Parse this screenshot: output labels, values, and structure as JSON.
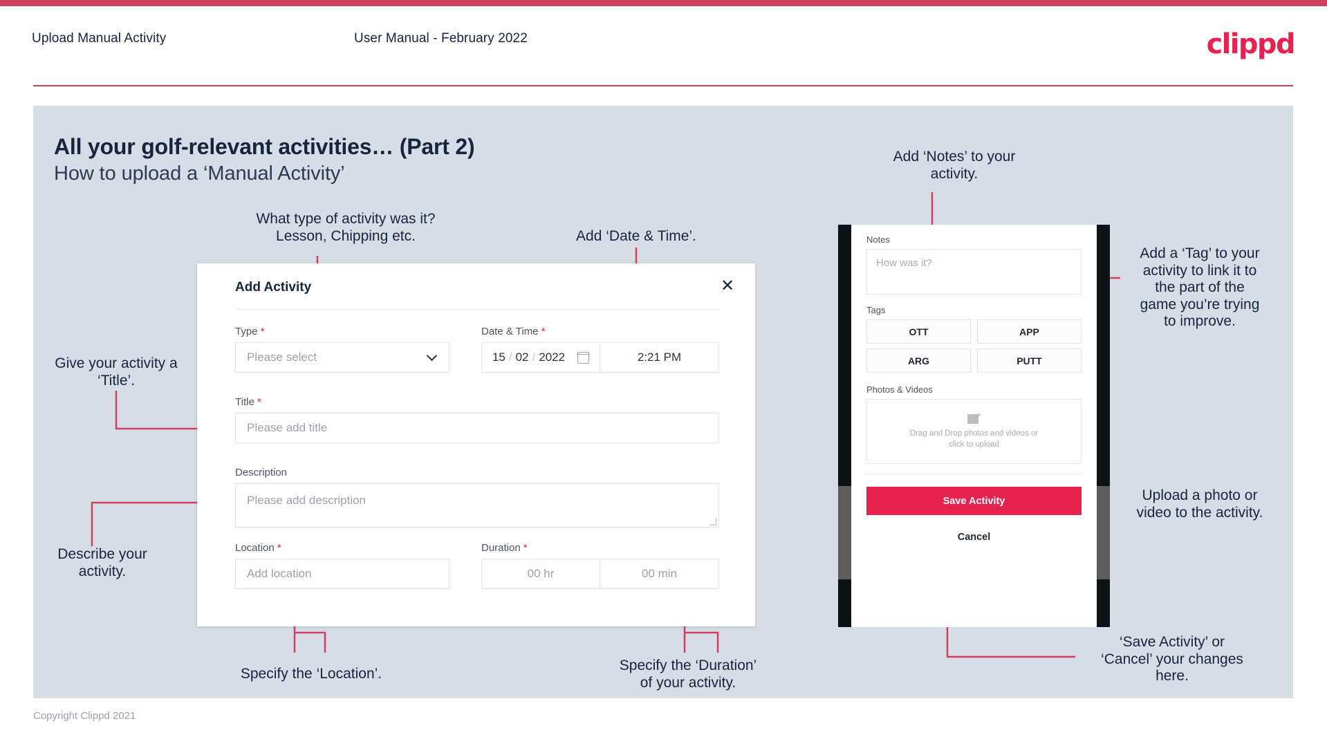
{
  "header": {
    "title": "Upload Manual Activity",
    "subtitle": "User Manual - February 2022",
    "logo": "clippd"
  },
  "slide": {
    "title": "All your golf-relevant activities… (Part 2)",
    "subtitle": "How to upload a ‘Manual Activity’",
    "copyright": "Copyright Clippd 2021"
  },
  "annotations": {
    "type": "What type of activity was it?\nLesson, Chipping etc.",
    "datetime": "Add ‘Date & Time’.",
    "title": "Give your activity a\n‘Title’.",
    "description": "Describe your\nactivity.",
    "location": "Specify the ‘Location’.",
    "duration": "Specify the ‘Duration’\nof your activity.",
    "notes": "Add ‘Notes’ to your\nactivity.",
    "tags": "Add a ‘Tag’ to your\nactivity to link it to\nthe part of the\ngame you’re trying\nto improve.",
    "photos": "Upload a photo or\nvideo to the activity.",
    "save": "‘Save Activity’ or\n‘Cancel’ your changes\nhere."
  },
  "modal": {
    "title": "Add Activity",
    "close_icon": "close-icon",
    "fields": {
      "type": {
        "label": "Type",
        "required": "*",
        "placeholder": "Please select"
      },
      "datetime": {
        "label": "Date & Time",
        "required": "*",
        "day": "15",
        "month": "02",
        "year": "2022",
        "sep": "/",
        "time": "2:21 PM"
      },
      "title": {
        "label": "Title",
        "required": "*",
        "placeholder": "Please add title"
      },
      "description": {
        "label": "Description",
        "required": "",
        "placeholder": "Please add description"
      },
      "location": {
        "label": "Location",
        "required": "*",
        "placeholder": "Add location"
      },
      "duration": {
        "label": "Duration",
        "required": "*",
        "hours": "00 hr",
        "minutes": "00 min"
      }
    }
  },
  "phone": {
    "notes": {
      "label": "Notes",
      "placeholder": "How was it?"
    },
    "tags": {
      "label": "Tags",
      "items": [
        "OTT",
        "APP",
        "ARG",
        "PUTT"
      ]
    },
    "photos": {
      "label": "Photos & Videos",
      "dropzone_line1": "Drag and Drop photos and videos or",
      "dropzone_line2": "click to upload",
      "icon": "add-image-icon"
    },
    "save_label": "Save Activity",
    "cancel_label": "Cancel"
  },
  "colors": {
    "accent": "#e8224f",
    "accent_dark": "#cf4060",
    "slide_bg": "#d7dde6",
    "text_dark": "#16243e"
  }
}
